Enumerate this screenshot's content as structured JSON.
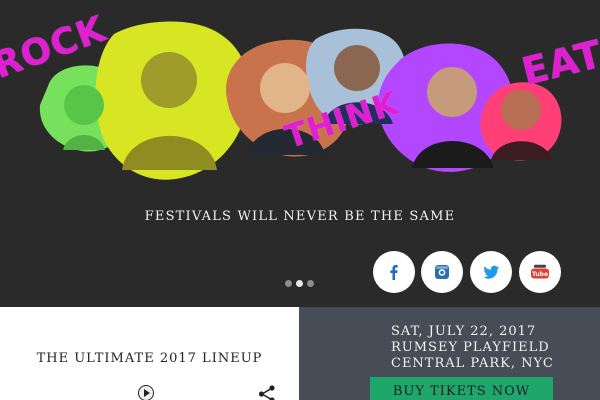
{
  "hero": {
    "words": {
      "rock": "ROCK",
      "think": "THINK",
      "eat": "EAT"
    },
    "tagline": "FESTIVALS WILL NEVER BE THE SAME",
    "slide": {
      "total": 3,
      "active": 2
    }
  },
  "social": [
    {
      "name": "facebook",
      "icon": "facebook-icon"
    },
    {
      "name": "instagram",
      "icon": "instagram-icon"
    },
    {
      "name": "twitter",
      "icon": "twitter-icon"
    },
    {
      "name": "youtube",
      "icon": "youtube-icon"
    }
  ],
  "lineup": {
    "title": "THE ULTIMATE 2017 LINEUP",
    "icons": [
      "play-icon",
      "share-icon"
    ]
  },
  "event": {
    "date": "SAT, JULY 22, 2017",
    "venue": "RUMSEY PLAYFIELD",
    "location": "CENTRAL PARK, NYC",
    "cta": "BUY TIKETS NOW"
  },
  "colors": {
    "accent": "#e01fd3",
    "background": "#2a2a2a",
    "event_panel": "#474d56",
    "button": "#1fa66a"
  }
}
